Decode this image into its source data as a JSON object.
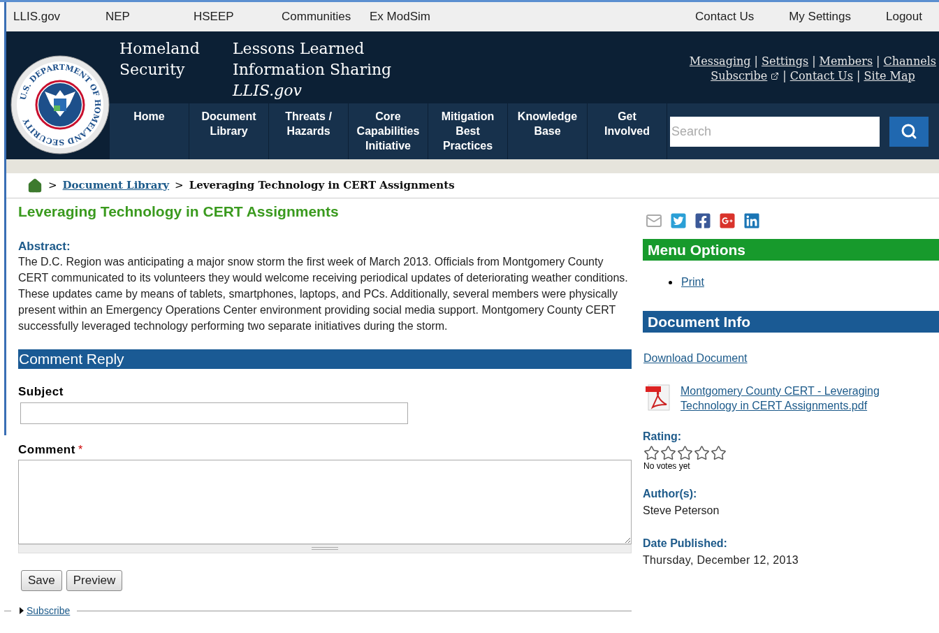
{
  "top_bar": {
    "left": [
      "LLIS.gov",
      "NEP",
      "HSEEP",
      "Communities",
      "Ex ModSim"
    ],
    "right": [
      "Contact Us",
      "My Settings",
      "Logout"
    ]
  },
  "header": {
    "seal_text": "U.S. DEPARTMENT OF HOMELAND SECURITY",
    "agency": "Homeland\nSecurity",
    "site_title": "Lessons Learned\nInformation Sharing",
    "site_subtitle": "LLIS.gov",
    "link_separator": "|",
    "links": [
      [
        "Messaging",
        "Settings",
        "Members",
        "Channels"
      ],
      [
        "Subscribe",
        "Contact Us",
        "Site Map"
      ]
    ]
  },
  "nav": [
    {
      "label": "Home"
    },
    {
      "label": "Document\nLibrary"
    },
    {
      "label": "Threats /\nHazards"
    },
    {
      "label": "Core\nCapabilities\nInitiative"
    },
    {
      "label": "Mitigation\nBest\nPractices"
    },
    {
      "label": "Knowledge\nBase"
    },
    {
      "label": "Get\nInvolved"
    }
  ],
  "search": {
    "placeholder": "Search"
  },
  "breadcrumb": {
    "separator": ">",
    "items": [
      {
        "kind": "home"
      },
      {
        "kind": "link",
        "label": "Document Library"
      },
      {
        "kind": "current",
        "label": "Leveraging Technology in CERT Assignments"
      }
    ]
  },
  "article": {
    "title": "Leveraging Technology in CERT Assignments",
    "abstract_label": "Abstract:",
    "abstract": "The D.C. Region was anticipating a major snow storm the first week of March 2013. Officials from Montgomery County CERT communicated to its volunteers they would welcome receiving periodical updates of deteriorating weather conditions. These updates came by means of tablets, smartphones, laptops, and PCs. Additionally, several members  were physically present within an Emergency Operations Center environment providing social media support. Montgomery County CERT successfully leveraged technology performing two separate initiatives during the storm."
  },
  "comment_form": {
    "title": "Comment Reply",
    "subject_label": "Subject",
    "comment_label": "Comment",
    "required_mark": "*",
    "buttons": [
      "Save",
      "Preview"
    ],
    "subscribe": "Subscribe"
  },
  "sidebar": {
    "share": [
      {
        "kind": "mail"
      },
      {
        "kind": "twitter"
      },
      {
        "kind": "facebook"
      },
      {
        "kind": "googleplus"
      },
      {
        "kind": "linkedin"
      }
    ],
    "menu_title": "Menu Options",
    "menu_items": [
      "Print"
    ],
    "info_title": "Document Info",
    "download": "Download Document",
    "file": "Montgomery County CERT - Leveraging Technology in CERT Assignments.pdf",
    "rating_label": "Rating:",
    "rating": {
      "stars": 0
    },
    "votes": "No votes yet",
    "author_label": "Author(s):",
    "author": "Steve Peterson",
    "date_label": "Date Published:",
    "date": "Thursday, December 12, 2013"
  }
}
